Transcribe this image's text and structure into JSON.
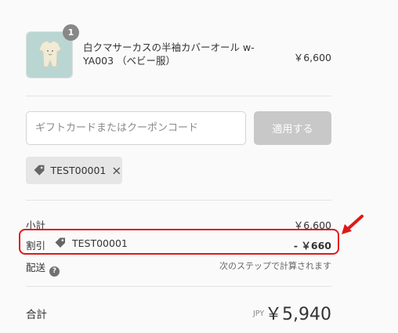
{
  "product": {
    "quantity": "1",
    "name": "白クマサーカスの半袖カバーオール w-YA003 （ベビー服）",
    "price": "￥6,600"
  },
  "coupon": {
    "placeholder": "ギフトカードまたはクーポンコード",
    "apply_label": "適用する",
    "applied_code": "TEST00001"
  },
  "summary": {
    "subtotal_label": "小計",
    "subtotal_value": "￥6,600",
    "discount_label": "割引",
    "discount_code": "TEST00001",
    "discount_value": "- ￥660",
    "shipping_label": "配送",
    "shipping_value": "次のステップで計算されます",
    "total_label": "合計",
    "currency": "JPY",
    "total_value": "￥5,940"
  },
  "colors": {
    "highlight": "#e01818",
    "button_disabled": "#c8c8c8",
    "chip_bg": "#e6e6e6"
  },
  "icons": [
    "tag-icon",
    "close-icon",
    "help-icon",
    "arrow-icon"
  ]
}
